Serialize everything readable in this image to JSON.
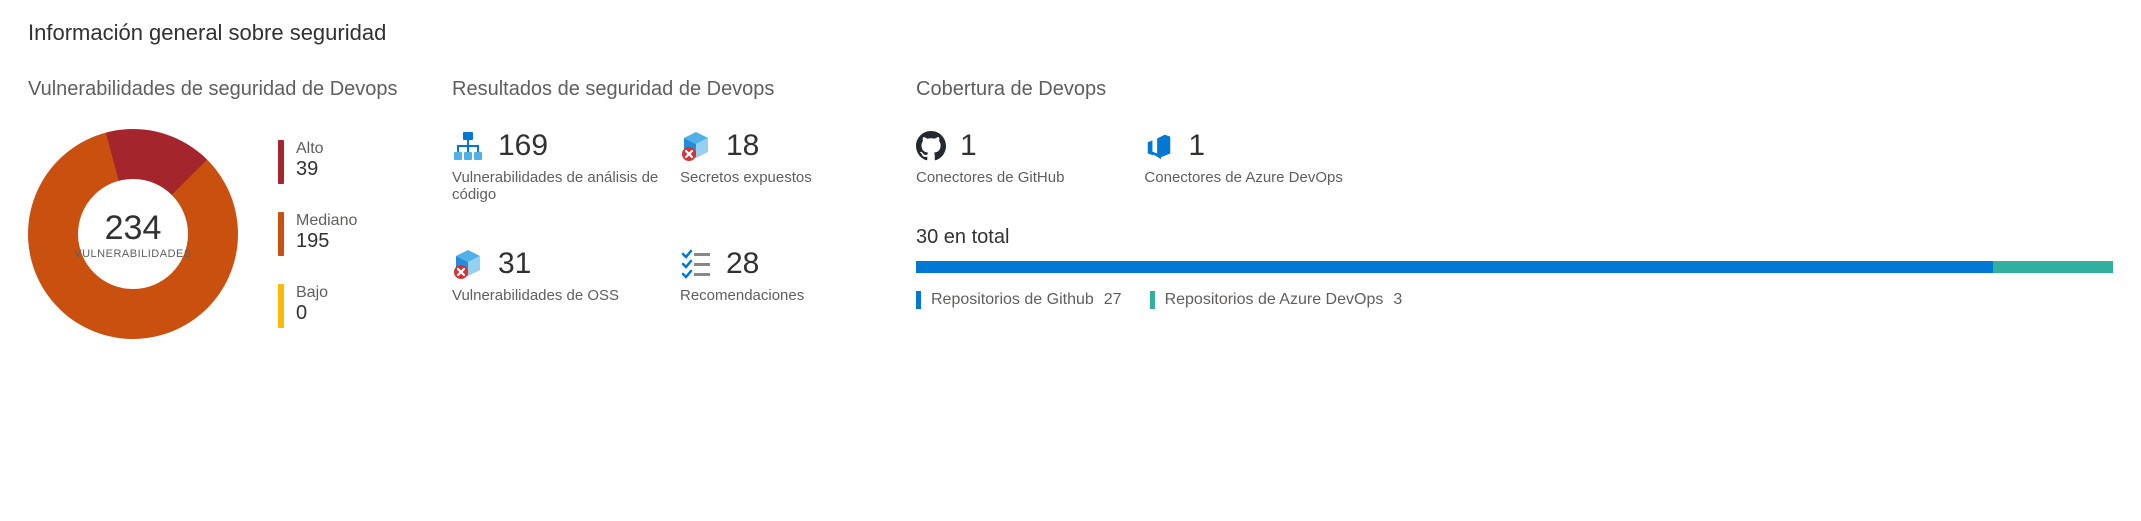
{
  "page_title": "Información general sobre seguridad",
  "colors": {
    "high": "#a4262c",
    "medium": "#ca5010",
    "low": "#ffb900",
    "blue": "#0078d4",
    "light_blue": "#50b0e8",
    "teal": "#31b0a0",
    "red_badge": "#d13438"
  },
  "vulnerabilities": {
    "title": "Vulnerabilidades de seguridad de Devops",
    "total": 234,
    "total_label": "VULNERABILIDADES",
    "breakdown": [
      {
        "name": "Alto",
        "value": 39,
        "color_key": "high"
      },
      {
        "name": "Mediano",
        "value": 195,
        "color_key": "medium"
      },
      {
        "name": "Bajo",
        "value": 0,
        "color_key": "low"
      }
    ]
  },
  "results": {
    "title": "Resultados de seguridad de Devops",
    "items": [
      {
        "icon": "org-chart-icon",
        "value": 169,
        "label": "Vulnerabilidades de análisis de código"
      },
      {
        "icon": "cube-alert-icon",
        "value": 18,
        "label": "Secretos expuestos"
      },
      {
        "icon": "cube-alert-icon",
        "value": 31,
        "label": "Vulnerabilidades de OSS"
      },
      {
        "icon": "checklist-icon",
        "value": 28,
        "label": "Recomendaciones"
      }
    ]
  },
  "coverage": {
    "title": "Cobertura de Devops",
    "connectors": [
      {
        "icon": "github-icon",
        "value": 1,
        "label": "Conectores de GitHub"
      },
      {
        "icon": "azure-devops-icon",
        "value": 1,
        "label": "Conectores de Azure DevOps"
      }
    ],
    "total_text": "30 en total",
    "total": 30,
    "segments": [
      {
        "name": "Repositorios de Github",
        "value": 27,
        "color_key": "blue"
      },
      {
        "name": "Repositorios de Azure DevOps",
        "value": 3,
        "color_key": "teal"
      }
    ]
  },
  "chart_data": [
    {
      "type": "pie",
      "title": "Vulnerabilidades de seguridad de Devops",
      "categories": [
        "Alto",
        "Mediano",
        "Bajo"
      ],
      "values": [
        39,
        195,
        0
      ],
      "total": 234,
      "colors": [
        "#a4262c",
        "#ca5010",
        "#ffb900"
      ]
    },
    {
      "type": "bar",
      "title": "Cobertura de Devops",
      "categories": [
        "Repositorios de Github",
        "Repositorios de Azure DevOps"
      ],
      "values": [
        27,
        3
      ],
      "total": 30,
      "colors": [
        "#0078d4",
        "#31b0a0"
      ]
    }
  ]
}
